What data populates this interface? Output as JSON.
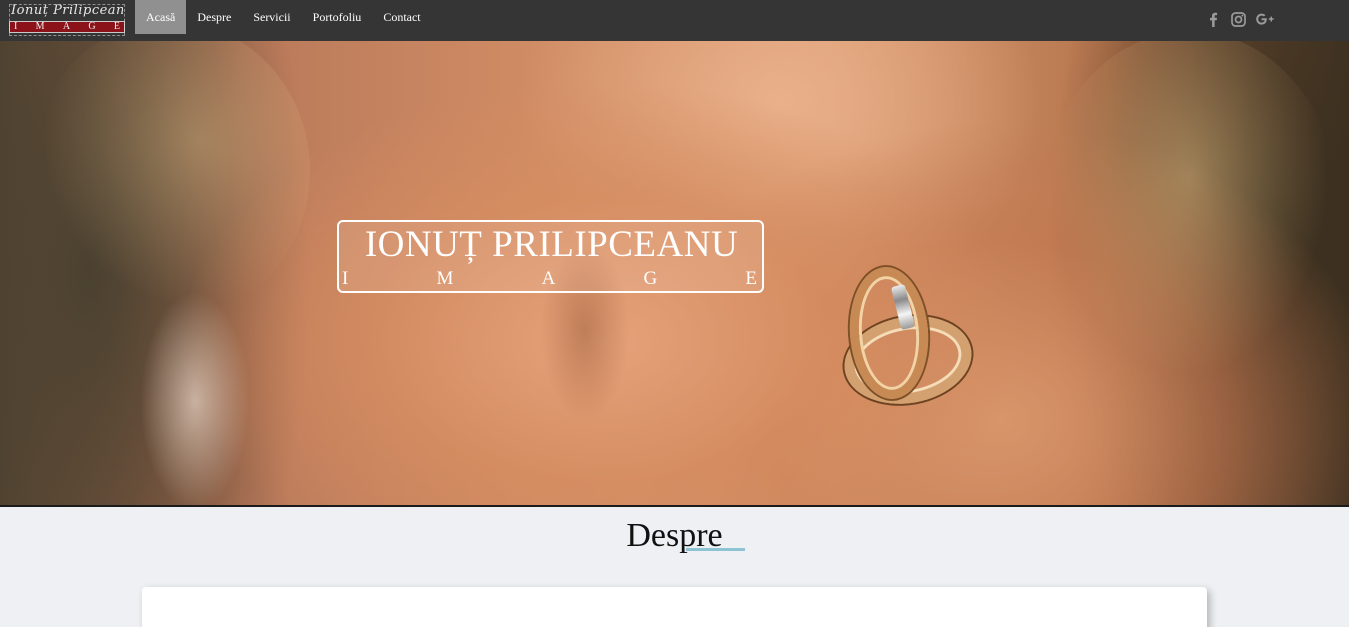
{
  "logo": {
    "script_text": "Ionuț Prilipceanu",
    "letters": [
      "I",
      "M",
      "A",
      "G",
      "E"
    ]
  },
  "nav": {
    "items": [
      {
        "label": "Acasă",
        "active": true
      },
      {
        "label": "Despre",
        "active": false
      },
      {
        "label": "Servicii",
        "active": false
      },
      {
        "label": "Portofoliu",
        "active": false
      },
      {
        "label": "Contact",
        "active": false
      }
    ]
  },
  "social": {
    "icons": [
      "facebook-icon",
      "instagram-icon",
      "google-plus-icon"
    ],
    "color": "#9a9a9a"
  },
  "hero": {
    "name": "IONUȚ PRILIPCEANU",
    "letters": [
      "I",
      "M",
      "A",
      "G",
      "E"
    ]
  },
  "about": {
    "title": "Despre",
    "underline_color": "#8ec3d4"
  },
  "colors": {
    "navbar": "#353535",
    "active_tab": "#909090",
    "page_background": "#eef0f3",
    "logo_red": "#8c1219"
  }
}
